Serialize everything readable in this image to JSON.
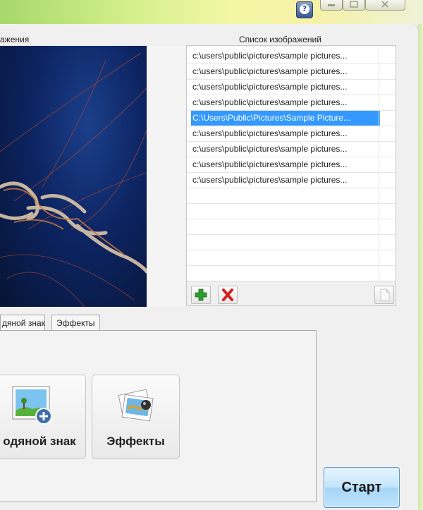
{
  "labels": {
    "preview": "ажения",
    "image_list": "Список изображений"
  },
  "window_controls": {
    "help": "?"
  },
  "file_list": [
    {
      "path": "c:\\users\\public\\pictures\\sample pictures...",
      "selected": false
    },
    {
      "path": "c:\\users\\public\\pictures\\sample pictures...",
      "selected": false
    },
    {
      "path": "c:\\users\\public\\pictures\\sample pictures...",
      "selected": false
    },
    {
      "path": "c:\\users\\public\\pictures\\sample pictures...",
      "selected": false
    },
    {
      "path": "C:\\Users\\Public\\Pictures\\Sample Picture...",
      "selected": true
    },
    {
      "path": "c:\\users\\public\\pictures\\sample pictures...",
      "selected": false
    },
    {
      "path": "c:\\users\\public\\pictures\\sample pictures...",
      "selected": false
    },
    {
      "path": "c:\\users\\public\\pictures\\sample pictures...",
      "selected": false
    },
    {
      "path": "c:\\users\\public\\pictures\\sample pictures...",
      "selected": false
    }
  ],
  "tabs": [
    {
      "label": "дяной знак"
    },
    {
      "label": "Эффекты"
    }
  ],
  "buttons": {
    "watermark": "одяной знак",
    "effects": "Эффекты",
    "start": "Старт"
  },
  "icons": {
    "add": "plus-icon",
    "remove": "cross-icon",
    "clear": "blank-page-icon",
    "watermark": "landscape-plus-icon",
    "effects": "photo-effects-icon"
  },
  "colors": {
    "selection": "#3399ff",
    "add_green": "#2e9b2e",
    "remove_red": "#d81e1e",
    "start_blue": "#bfe3fb"
  }
}
